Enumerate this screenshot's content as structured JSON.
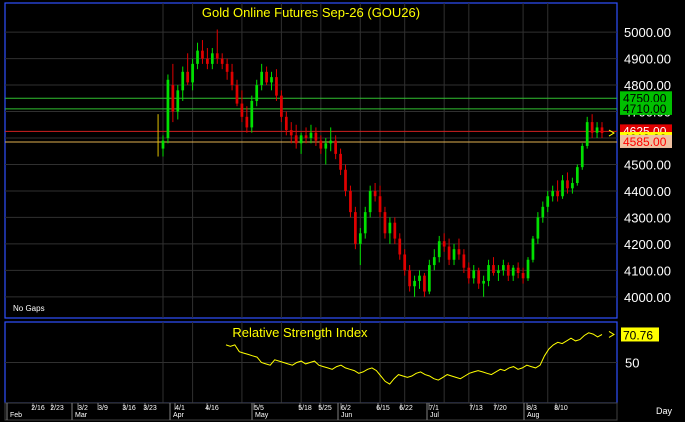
{
  "chart_data": [
    {
      "type": "candlestick",
      "title": "Gold  Online  Futures  Sep-26  (GOU26)",
      "note": "No  Gaps",
      "ylim": [
        3920,
        5110
      ],
      "y_ticks": [
        4000,
        4100,
        4200,
        4300,
        4400,
        4500,
        4600,
        4700,
        4800,
        4900,
        5000
      ],
      "y_tick_labels": [
        "4000.00",
        "4100.00",
        "4200.00",
        "4300.00",
        "4400.00",
        "4500.00",
        "4600.00",
        "4700.00",
        "4800.00",
        "4900.00",
        "5000.00"
      ],
      "colors": {
        "up": "#00e000",
        "down": "#e00000",
        "neutral": "#e0c000",
        "title": "#ffff00",
        "axis_text": "#ffffff",
        "grid": "#303030",
        "frame": "#3050ff"
      },
      "levels": [
        {
          "value": 4750,
          "label": "4750.00",
          "line": "#30c030",
          "bg": "#00c000",
          "fg": "#000000"
        },
        {
          "value": 4710,
          "label": "4710.00",
          "line": "#30c030",
          "bg": "#00c000",
          "fg": "#000000"
        },
        {
          "value": 4625,
          "label": "4625.00",
          "line": "#d02020",
          "bg": "#e00000",
          "fg": "#ffffff"
        },
        {
          "value": 4618.8,
          "label": "4618.80",
          "line": null,
          "bg": "#ffff00",
          "fg": "#000000"
        },
        {
          "value": 4585,
          "label": "4585.00",
          "line": "#e0b050",
          "bg": "#f0c0a0",
          "fg": "#ff0000"
        }
      ],
      "last": 4618.8,
      "ohlc": [
        [
          4560,
          4610,
          4530,
          4590
        ],
        [
          4600,
          4840,
          4580,
          4820
        ],
        [
          4800,
          4880,
          4660,
          4700
        ],
        [
          4700,
          4800,
          4670,
          4780
        ],
        [
          4780,
          4870,
          4740,
          4850
        ],
        [
          4850,
          4920,
          4800,
          4810
        ],
        [
          4810,
          4900,
          4780,
          4880
        ],
        [
          4880,
          4960,
          4860,
          4930
        ],
        [
          4930,
          4970,
          4880,
          4900
        ],
        [
          4900,
          4940,
          4860,
          4880
        ],
        [
          4880,
          4940,
          4860,
          4920
        ],
        [
          4920,
          5010,
          4880,
          4900
        ],
        [
          4900,
          4920,
          4860,
          4880
        ],
        [
          4880,
          4900,
          4820,
          4850
        ],
        [
          4850,
          4880,
          4780,
          4800
        ],
        [
          4800,
          4820,
          4720,
          4730
        ],
        [
          4730,
          4780,
          4660,
          4680
        ],
        [
          4680,
          4720,
          4620,
          4640
        ],
        [
          4640,
          4760,
          4620,
          4740
        ],
        [
          4740,
          4820,
          4720,
          4800
        ],
        [
          4800,
          4880,
          4780,
          4850
        ],
        [
          4850,
          4870,
          4800,
          4810
        ],
        [
          4810,
          4850,
          4780,
          4830
        ],
        [
          4830,
          4860,
          4740,
          4760
        ],
        [
          4760,
          4780,
          4660,
          4680
        ],
        [
          4680,
          4700,
          4610,
          4630
        ],
        [
          4630,
          4660,
          4580,
          4610
        ],
        [
          4610,
          4650,
          4560,
          4580
        ],
        [
          4580,
          4620,
          4540,
          4610
        ],
        [
          4610,
          4640,
          4580,
          4600
        ],
        [
          4600,
          4650,
          4580,
          4620
        ],
        [
          4620,
          4640,
          4570,
          4590
        ],
        [
          4590,
          4610,
          4540,
          4560
        ],
        [
          4560,
          4600,
          4500,
          4580
        ],
        [
          4580,
          4640,
          4550,
          4590
        ],
        [
          4590,
          4610,
          4520,
          4540
        ],
        [
          4540,
          4560,
          4460,
          4480
        ],
        [
          4480,
          4500,
          4380,
          4400
        ],
        [
          4400,
          4420,
          4300,
          4320
        ],
        [
          4320,
          4340,
          4180,
          4200
        ],
        [
          4200,
          4260,
          4120,
          4240
        ],
        [
          4240,
          4340,
          4220,
          4320
        ],
        [
          4320,
          4420,
          4300,
          4400
        ],
        [
          4400,
          4430,
          4360,
          4380
        ],
        [
          4380,
          4420,
          4300,
          4320
        ],
        [
          4320,
          4340,
          4220,
          4240
        ],
        [
          4240,
          4300,
          4200,
          4280
        ],
        [
          4280,
          4300,
          4200,
          4220
        ],
        [
          4220,
          4240,
          4140,
          4160
        ],
        [
          4160,
          4180,
          4080,
          4100
        ],
        [
          4100,
          4120,
          4020,
          4040
        ],
        [
          4040,
          4080,
          4000,
          4060
        ],
        [
          4060,
          4100,
          4030,
          4080
        ],
        [
          4080,
          4090,
          4000,
          4020
        ],
        [
          4020,
          4140,
          4010,
          4120
        ],
        [
          4120,
          4180,
          4100,
          4150
        ],
        [
          4150,
          4230,
          4130,
          4210
        ],
        [
          4210,
          4240,
          4170,
          4190
        ],
        [
          4190,
          4220,
          4120,
          4140
        ],
        [
          4140,
          4200,
          4120,
          4180
        ],
        [
          4180,
          4220,
          4140,
          4160
        ],
        [
          4160,
          4180,
          4090,
          4110
        ],
        [
          4110,
          4130,
          4050,
          4070
        ],
        [
          4070,
          4120,
          4050,
          4100
        ],
        [
          4100,
          4110,
          4030,
          4050
        ],
        [
          4050,
          4080,
          4000,
          4060
        ],
        [
          4060,
          4140,
          4040,
          4120
        ],
        [
          4120,
          4150,
          4080,
          4090
        ],
        [
          4090,
          4120,
          4060,
          4100
        ],
        [
          4100,
          4140,
          4080,
          4120
        ],
        [
          4120,
          4130,
          4060,
          4080
        ],
        [
          4080,
          4120,
          4060,
          4110
        ],
        [
          4110,
          4130,
          4070,
          4090
        ],
        [
          4090,
          4110,
          4050,
          4070
        ],
        [
          4070,
          4150,
          4060,
          4140
        ],
        [
          4140,
          4230,
          4130,
          4220
        ],
        [
          4220,
          4320,
          4200,
          4300
        ],
        [
          4300,
          4360,
          4280,
          4340
        ],
        [
          4340,
          4400,
          4320,
          4380
        ],
        [
          4380,
          4420,
          4360,
          4400
        ],
        [
          4400,
          4440,
          4360,
          4380
        ],
        [
          4380,
          4460,
          4370,
          4440
        ],
        [
          4440,
          4470,
          4390,
          4410
        ],
        [
          4410,
          4450,
          4390,
          4430
        ],
        [
          4430,
          4500,
          4420,
          4490
        ],
        [
          4490,
          4580,
          4480,
          4570
        ],
        [
          4570,
          4680,
          4560,
          4660
        ],
        [
          4660,
          4690,
          4600,
          4620
        ],
        [
          4620,
          4660,
          4600,
          4640
        ],
        [
          4640,
          4660,
          4600,
          4618.8
        ]
      ],
      "x_ticks": [
        {
          "index": 0,
          "label": "4/1"
        },
        {
          "index": 6,
          "label": "4/16"
        },
        {
          "index": 16,
          "label": "5/5"
        },
        {
          "index": 24,
          "label": "5/18"
        },
        {
          "index": 28,
          "label": "5/25"
        },
        {
          "index": 32,
          "label": "6/2"
        },
        {
          "index": 40,
          "label": "6/15"
        },
        {
          "index": 44,
          "label": "6/22"
        },
        {
          "index": 49,
          "label": "7/1"
        },
        {
          "index": 57,
          "label": "7/13"
        },
        {
          "index": 62,
          "label": "7/20"
        },
        {
          "index": 73,
          "label": "8/3"
        },
        {
          "index": 78,
          "label": "8/10"
        }
      ]
    },
    {
      "type": "line",
      "title": "Relative  Strength  Index",
      "series": [
        {
          "color": "#ffff00",
          "values": [
            63,
            62,
            63,
            58,
            57,
            56,
            55,
            54,
            50,
            49,
            48,
            52,
            51,
            50,
            49,
            48,
            50,
            51,
            49,
            50,
            51,
            48,
            47,
            46,
            45,
            47,
            48,
            46,
            45,
            44,
            42,
            43,
            45,
            46,
            44,
            40,
            36,
            34,
            38,
            41,
            40,
            39,
            40,
            42,
            43,
            41,
            40,
            38,
            37,
            39,
            41,
            40,
            39,
            38,
            40,
            42,
            43,
            44,
            43,
            42,
            41,
            43,
            45,
            44,
            46,
            47,
            45,
            46,
            48,
            47,
            46,
            48,
            55,
            60,
            63,
            65,
            64,
            66,
            68,
            66,
            67,
            70,
            72,
            71,
            69,
            70.76
          ]
        }
      ],
      "ylim": [
        20,
        80
      ],
      "y_ticks": [
        50
      ],
      "y_tick_labels": [
        "50"
      ],
      "last_label": "70.76",
      "x_axis": {
        "labels": [
          "2/16",
          "2/23",
          "3/2",
          "3/9",
          "3/16",
          "3/23",
          "4/1",
          "4/16",
          "5/5",
          "5/18",
          "5/25",
          "6/2",
          "6/15",
          "6/22",
          "7/1",
          "7/13",
          "7/20",
          "8/3",
          "8/10"
        ],
        "months": [
          "Feb",
          "Mar",
          "Apr",
          "May",
          "Jun",
          "Jul",
          "Aug"
        ],
        "unit_label": "Day"
      }
    }
  ]
}
